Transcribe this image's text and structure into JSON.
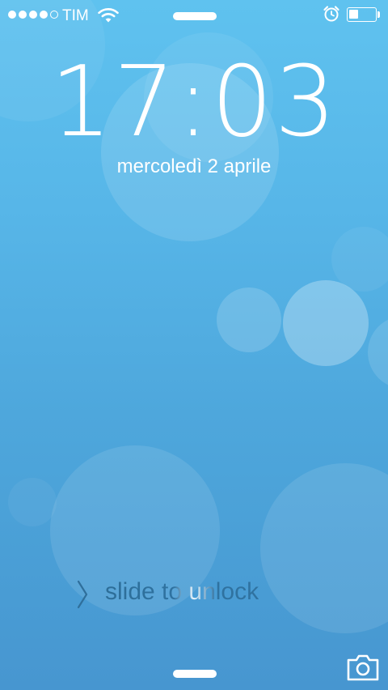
{
  "status_bar": {
    "signal_bars_filled": 4,
    "signal_bars_total": 5,
    "carrier": "TIM",
    "wifi_icon": "wifi-icon",
    "alarm_icon": "alarm-clock-icon",
    "battery_level": 0.35
  },
  "lock_screen": {
    "time": "17:03",
    "date": "mercoledì 2 aprile",
    "slide_to_unlock": "slide to unlock",
    "camera_icon": "camera-icon"
  },
  "colors": {
    "background_top": "#5fc2ef",
    "background_bottom": "#4796d0",
    "slider_text": "#2f72a0",
    "foreground": "#ffffff"
  }
}
